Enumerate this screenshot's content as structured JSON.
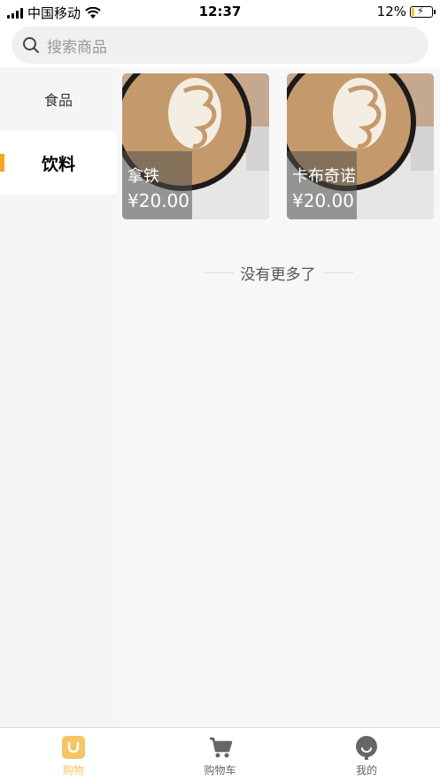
{
  "status_bar": {
    "carrier": "中国移动",
    "time": "12:37",
    "battery": "12%",
    "battery_level": 0.12
  },
  "search": {
    "placeholder": "搜索商品"
  },
  "sidebar": {
    "items": [
      {
        "label": "食品",
        "active": false
      },
      {
        "label": "饮料",
        "active": true
      }
    ]
  },
  "products": [
    {
      "name": "拿铁",
      "price": "¥20.00"
    },
    {
      "name": "卡布奇诺",
      "price": "¥20.00"
    }
  ],
  "list_end_text": "没有更多了",
  "tabbar": {
    "items": [
      {
        "label": "购物",
        "icon": "shop-bag-icon",
        "active": true
      },
      {
        "label": "购物车",
        "icon": "cart-icon",
        "active": false
      },
      {
        "label": "我的",
        "icon": "profile-icon",
        "active": false
      }
    ]
  },
  "colors": {
    "accent": "#f5a623",
    "tab_active": "#f5c463"
  }
}
